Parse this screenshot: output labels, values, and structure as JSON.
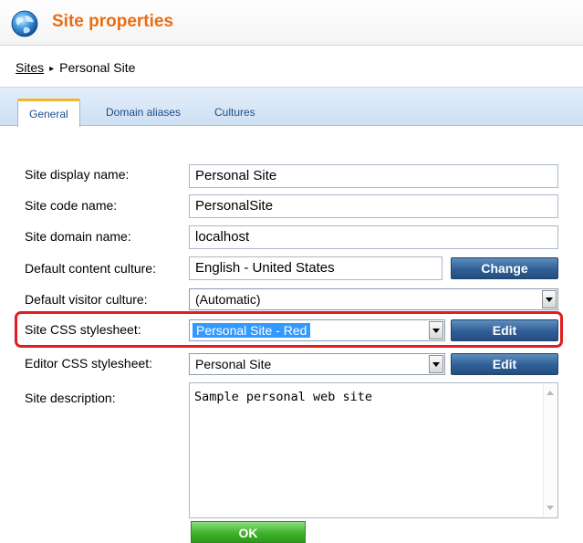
{
  "header": {
    "title": "Site properties",
    "icon": "globe-icon"
  },
  "breadcrumb": {
    "link": "Sites",
    "separator": "▸",
    "current": "Personal Site"
  },
  "tabs": [
    {
      "label": "General",
      "active": true
    },
    {
      "label": "Domain aliases",
      "active": false
    },
    {
      "label": "Cultures",
      "active": false
    }
  ],
  "form": {
    "display_name": {
      "label": "Site display name:",
      "value": "Personal Site"
    },
    "code_name": {
      "label": "Site code name:",
      "value": "PersonalSite"
    },
    "domain_name": {
      "label": "Site domain name:",
      "value": "localhost"
    },
    "content_culture": {
      "label": "Default content culture:",
      "value": "English - United States",
      "button": "Change"
    },
    "visitor_culture": {
      "label": "Default visitor culture:",
      "value": "(Automatic)"
    },
    "site_css": {
      "label": "Site CSS stylesheet:",
      "value": "Personal Site - Red",
      "button": "Edit"
    },
    "editor_css": {
      "label": "Editor CSS stylesheet:",
      "value": "Personal Site",
      "button": "Edit"
    },
    "description": {
      "label": "Site description:",
      "value": "Sample personal web site"
    }
  },
  "ok_button": "OK",
  "colors": {
    "title": "#ea6d10",
    "highlight_box": "#e21d1d",
    "selected_option": "#3399ff",
    "ok_button": "#3fb12c",
    "action_button": "#2f5f96"
  }
}
